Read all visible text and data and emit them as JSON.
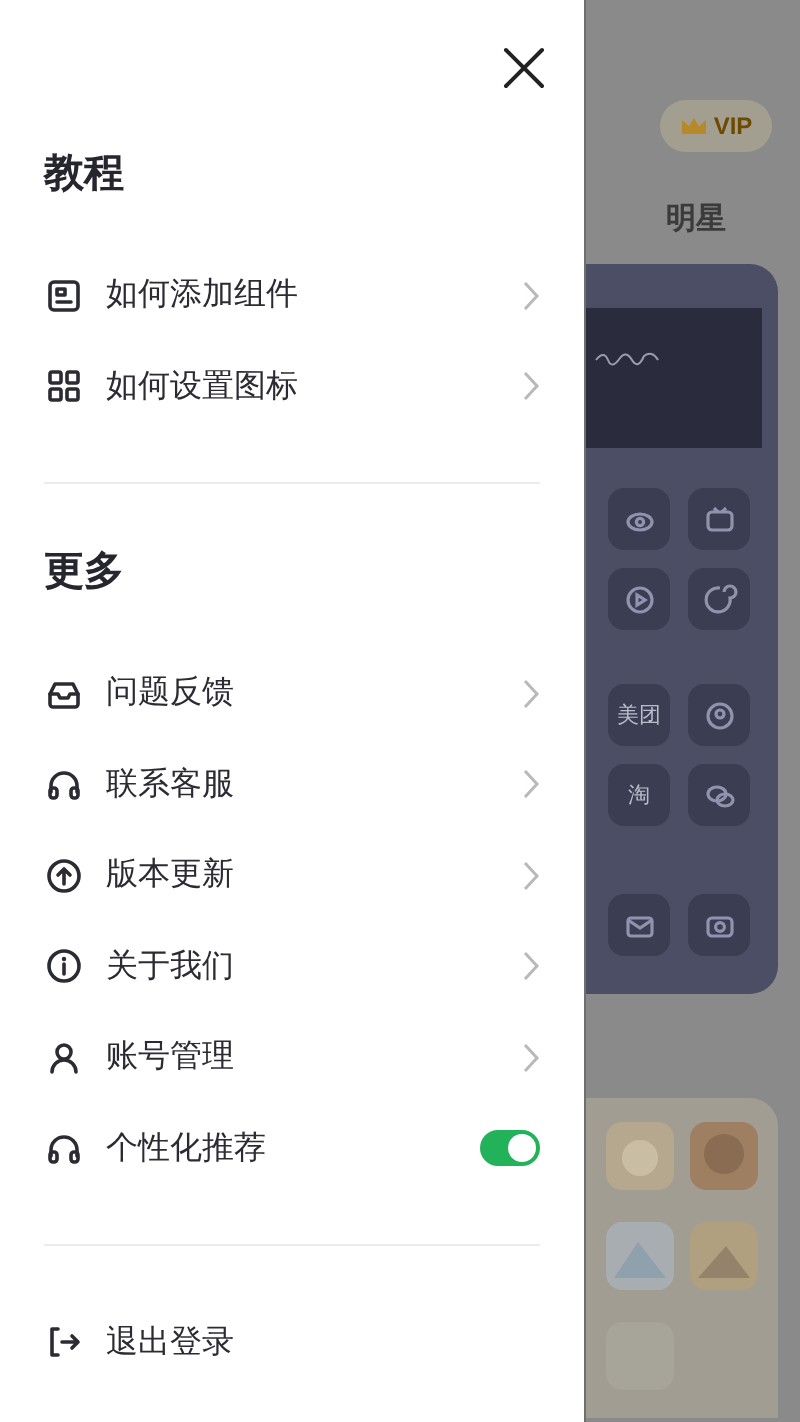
{
  "sections": [
    {
      "title": "教程",
      "items": [
        {
          "kind": "link",
          "label": "如何添加组件"
        },
        {
          "kind": "link",
          "label": "如何设置图标"
        }
      ]
    },
    {
      "title": "更多",
      "items": [
        {
          "kind": "link",
          "label": "问题反馈"
        },
        {
          "kind": "link",
          "label": "联系客服"
        },
        {
          "kind": "link",
          "label": "版本更新"
        },
        {
          "kind": "link",
          "label": "关于我们"
        },
        {
          "kind": "link",
          "label": "账号管理"
        },
        {
          "kind": "toggle",
          "label": "个性化推荐",
          "on": true
        }
      ]
    }
  ],
  "logout": {
    "label": "退出登录"
  },
  "background": {
    "vip_badge": "VIP",
    "tab": "明星",
    "tiles": [
      "美团",
      "淘"
    ]
  }
}
